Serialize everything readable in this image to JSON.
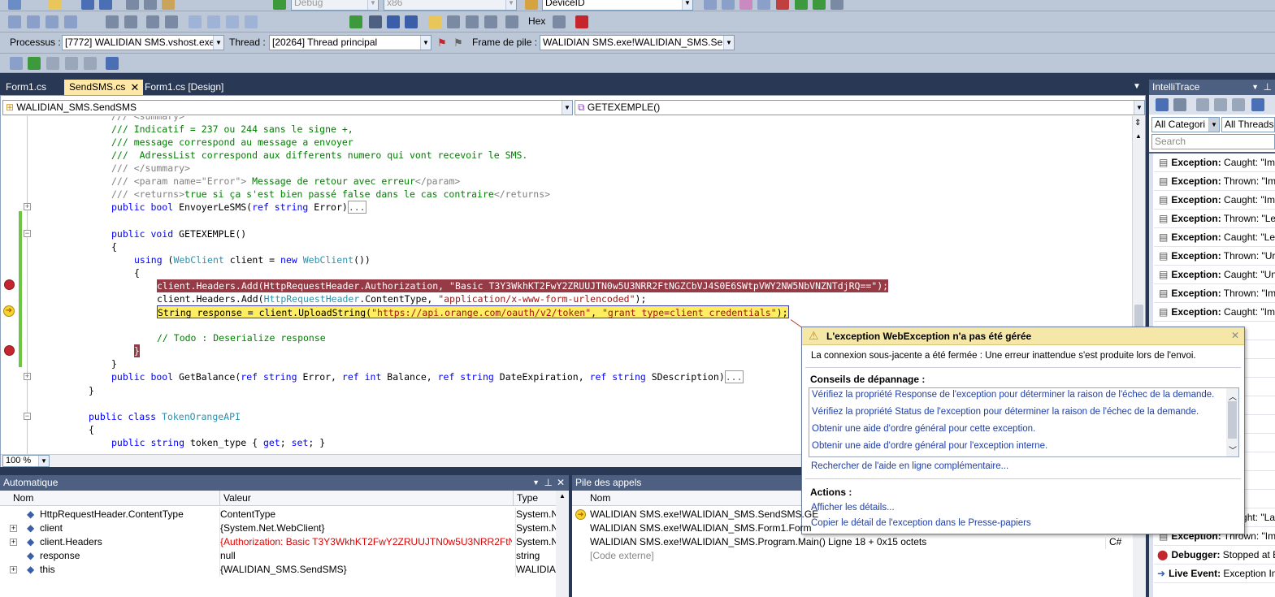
{
  "toolbar1": {
    "config": "Debug",
    "platform": "x86",
    "search_combo": "DeviceID",
    "hex_label": "Hex"
  },
  "toolbar2": {
    "process_label": "Processus :",
    "process_value": "[7772] WALIDIAN SMS.vshost.exe",
    "thread_label": "Thread :",
    "thread_value": "[20264] Thread principal",
    "frame_label": "Frame de pile :",
    "frame_value": "WALIDIAN SMS.exe!WALIDIAN_SMS.Send!"
  },
  "tabs": [
    {
      "label": "Form1.cs"
    },
    {
      "label": "SendSMS.cs"
    },
    {
      "label": "Form1.cs [Design]"
    }
  ],
  "editor": {
    "class_combo": "WALIDIAN_SMS.SendSMS",
    "member_combo": "GETEXEMPLE()",
    "zoom": "100 %",
    "lines": {
      "l0": "/// <summary>",
      "l1": "/// Indicatif = 237 ou 244 sans le signe +,",
      "l2": "/// message correspond au message a envoyer",
      "l3": "///  AdressList correspond aux differents numero qui vont recevoir le SMS.",
      "l4": "/// </summary>",
      "l5a": "/// ",
      "l5b": "<param name=\"Error\">",
      "l5c": " Message de retour avec erreur",
      "l5d": "</param>",
      "l6a": "/// ",
      "l6b": "<returns>",
      "l6c": "true si ça s'est bien passé false dans le cas contraire",
      "l6d": "</returns>",
      "l7a": "public bool ",
      "l7b": "EnvoyerLeSMS(",
      "l7c": "ref string ",
      "l7d": "Error)",
      "l7e": "...",
      "l8a": "public void ",
      "l8b": "GETEXEMPLE()",
      "l9": "{",
      "l10a": "using ",
      "l10b": "(",
      "l10c": "WebClient",
      "l10d": " client = ",
      "l10e": "new ",
      "l10f": "WebClient",
      "l10g": "())",
      "l11": "{",
      "l12a": "client.Headers.Add(HttpRequestHeader.Authorization, ",
      "l12b": "\"Basic T3Y3WkhKT2FwY2ZRUUJTN0w5U3NRR2FtNGZCbVJ4S0E6SWtpVWY2NW5NbVNZNTdjRQ==\"",
      "l12c": ");",
      "l13a": "client.Headers.Add(",
      "l13b": "HttpRequestHeader",
      "l13c": ".ContentType, ",
      "l13d": "\"application/x-www-form-urlencoded\"",
      "l13e": ");",
      "l14a": "String response = client.UploadString(",
      "l14b": "\"https://api.orange.com/oauth/v2/token\"",
      "l14c": ", ",
      "l14d": "\"grant_type=client_credentials\"",
      "l14e": ");",
      "l15": "// Todo : Deserialize response",
      "l16": "}",
      "l17": "}",
      "l18a": "public bool ",
      "l18b": "GetBalance(",
      "l18c": "ref string ",
      "l18d": "Error, ",
      "l18e": "ref int ",
      "l18f": "Balance, ",
      "l18g": "ref string ",
      "l18h": "DateExpiration, ",
      "l18i": "ref string ",
      "l18j": "SDescription)",
      "l18k": "...",
      "l19": "}",
      "l20a": "public class ",
      "l20b": "TokenOrangeAPI",
      "l21": "{",
      "l22a": "public string ",
      "l22b": "token_type { ",
      "l22c": "get",
      "l22d": "; ",
      "l22e": "set",
      "l22f": "; }"
    }
  },
  "exception_popup": {
    "title": "L'exception WebException n'a pas été gérée",
    "message": "La connexion sous-jacente a été fermée : Une erreur inattendue s'est produite lors de l'envoi.",
    "tips_heading": "Conseils de dépannage :",
    "tips": [
      "Vérifiez la propriété Response de l'exception pour déterminer la raison de l'échec de la demande.",
      "Vérifiez la propriété Status de l'exception pour déterminer la raison de l'échec de la demande.",
      "Obtenir une aide d'ordre général pour cette exception.",
      "Obtenir une aide d'ordre général pour l'exception interne."
    ],
    "online_help": "Rechercher de l'aide en ligne complémentaire...",
    "actions_heading": "Actions :",
    "actions": [
      "Afficher les détails...",
      "Copier le détail de l'exception dans le Presse-papiers"
    ]
  },
  "autos": {
    "title": "Automatique",
    "col_name": "Nom",
    "col_value": "Valeur",
    "col_type": "Type",
    "rows": [
      {
        "name": "HttpRequestHeader.ContentType",
        "value": "ContentType",
        "type": "System.N"
      },
      {
        "name": "client",
        "value": "{System.Net.WebClient}",
        "type": "System.N"
      },
      {
        "name": "client.Headers",
        "value": "{Authorization: Basic T3Y3WkhKT2FwY2ZRUUJTN0w5U3NRR2FtNGZC",
        "type": "System.N"
      },
      {
        "name": "response",
        "value": "null",
        "type": "string"
      },
      {
        "name": "this",
        "value": "{WALIDIAN_SMS.SendSMS}",
        "type": "WALIDIA"
      }
    ]
  },
  "callstack": {
    "title": "Pile des appels",
    "col_name": "Nom",
    "rows": [
      {
        "name": "WALIDIAN SMS.exe!WALIDIAN_SMS.SendSMS.GE",
        "lang": ""
      },
      {
        "name": "WALIDIAN SMS.exe!WALIDIAN_SMS.Form1.Form",
        "lang": ""
      },
      {
        "name": "WALIDIAN SMS.exe!WALIDIAN_SMS.Program.Main() Ligne 18 + 0x15 octets",
        "lang": "C#"
      },
      {
        "name": "[Code externe]",
        "lang": ""
      }
    ]
  },
  "intellitrace": {
    "title": "IntelliTrace",
    "categories": "All Categori",
    "threads": "All Threads",
    "search_placeholder": "Search",
    "events": [
      {
        "kind": "Exception:",
        "text": " Caught: \"Im"
      },
      {
        "kind": "Exception:",
        "text": " Thrown: \"Im"
      },
      {
        "kind": "Exception:",
        "text": " Caught: \"Im"
      },
      {
        "kind": "Exception:",
        "text": " Thrown: \"Le"
      },
      {
        "kind": "Exception:",
        "text": " Caught: \"Le"
      },
      {
        "kind": "Exception:",
        "text": " Thrown: \"Ur"
      },
      {
        "kind": "Exception:",
        "text": " Caught: \"Un"
      },
      {
        "kind": "Exception:",
        "text": " Thrown: \"Im"
      },
      {
        "kind": "Exception:",
        "text": " Caught: \"Im"
      },
      {
        "kind": "",
        "text": "wn: \"Im"
      },
      {
        "kind": "",
        "text": "wn: \"Im"
      },
      {
        "kind": "",
        "text": "wn: \"Im"
      },
      {
        "kind": "",
        "text": "wn: \"Ur"
      },
      {
        "kind": "",
        "text": "wn: \"Im"
      },
      {
        "kind": "",
        "text": "wn: \"Im"
      },
      {
        "kind": "",
        "text": "wn: \"Im"
      },
      {
        "kind": "",
        "text": "wn: \"Im"
      },
      {
        "kind": "",
        "text": "wn: \"Le"
      },
      {
        "kind": "",
        "text": "wn: \"La"
      },
      {
        "kind": "Exception:",
        "text": " Caught: \"La"
      },
      {
        "kind": "Exception:",
        "text": " Thrown: \"Im"
      },
      {
        "kind": "Debugger:",
        "text": " Stopped at E"
      },
      {
        "kind": "Live Event:",
        "text": " Exception In"
      }
    ]
  }
}
